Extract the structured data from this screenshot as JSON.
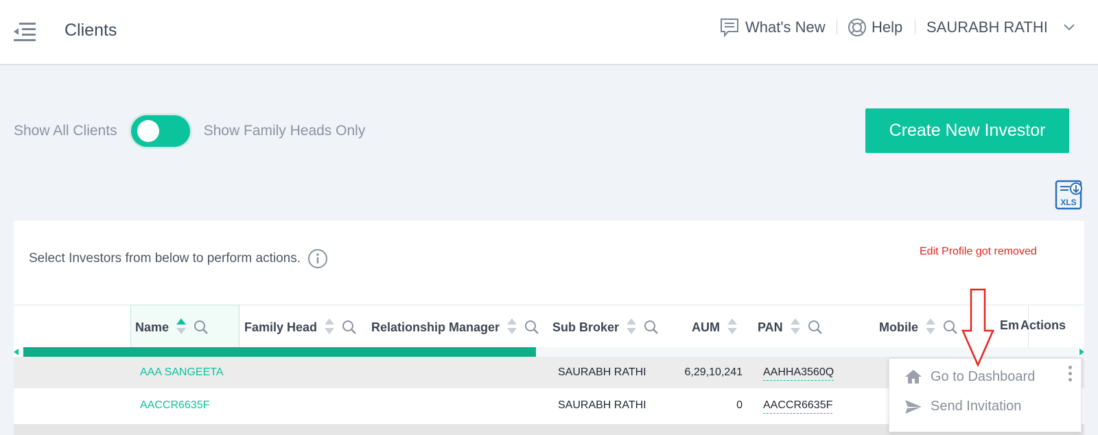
{
  "header": {
    "title": "Clients",
    "whats_new": "What's New",
    "help": "Help",
    "user": "SAURABH RATHI"
  },
  "filters": {
    "show_all": "Show All Clients",
    "family_heads": "Show Family Heads Only"
  },
  "create_button": "Create New Investor",
  "xls_label": "XLS",
  "card": {
    "hint": "Select Investors from below to perform actions.",
    "note": "Edit Profile got removed"
  },
  "columns": {
    "name": "Name",
    "family_head": "Family Head",
    "relationship_manager": "Relationship Manager",
    "sub_broker": "Sub Broker",
    "aum": "AUM",
    "pan": "PAN",
    "mobile": "Mobile",
    "email_partial": "Em",
    "actions": "Actions"
  },
  "rows": [
    {
      "name": "AAA SANGEETA",
      "sub_broker": "SAURABH RATHI",
      "aum": "6,29,10,241",
      "pan": "AAHHA3560Q"
    },
    {
      "name": "AACCR6635F",
      "sub_broker": "SAURABH RATHI",
      "aum": "0",
      "pan": "AACCR6635F"
    }
  ],
  "dropdown": {
    "go_dashboard": "Go to Dashboard",
    "send_invitation": "Send Invitation"
  },
  "colors": {
    "accent": "#0bc39c",
    "note_red": "#e8231f"
  }
}
